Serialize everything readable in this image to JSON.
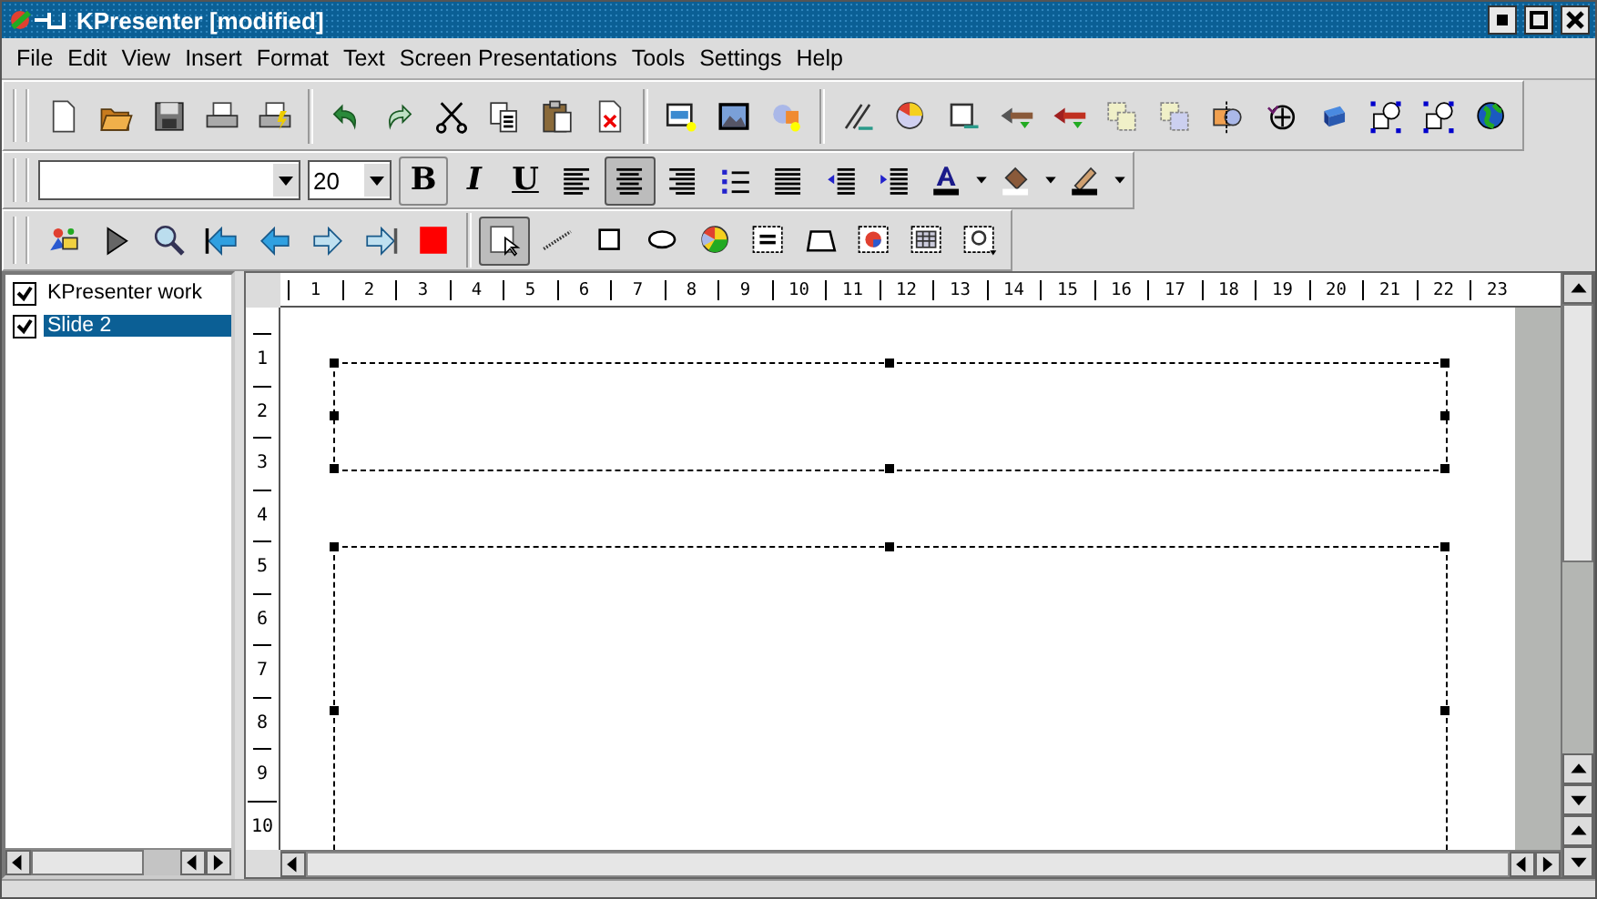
{
  "window": {
    "title": "KPresenter [modified]"
  },
  "menu": [
    {
      "label": "File"
    },
    {
      "label": "Edit"
    },
    {
      "label": "View"
    },
    {
      "label": "Insert"
    },
    {
      "label": "Format"
    },
    {
      "label": "Text"
    },
    {
      "label": "Screen Presentations"
    },
    {
      "label": "Tools"
    },
    {
      "label": "Settings"
    },
    {
      "label": "Help"
    }
  ],
  "toolbar_main": [
    {
      "buttons": [
        {
          "kind": "new"
        },
        {
          "kind": "open"
        },
        {
          "kind": "save"
        },
        {
          "kind": "print"
        },
        {
          "kind": "preview"
        }
      ]
    },
    {
      "buttons": [
        {
          "kind": "undo"
        },
        {
          "kind": "redo"
        },
        {
          "kind": "cut"
        },
        {
          "kind": "copy"
        },
        {
          "kind": "paste"
        },
        {
          "kind": "delete"
        }
      ]
    },
    {
      "buttons": [
        {
          "kind": "slide"
        },
        {
          "kind": "image"
        },
        {
          "kind": "clipart"
        }
      ]
    },
    {
      "buttons": [
        {
          "kind": "pen"
        },
        {
          "kind": "palette"
        },
        {
          "kind": "frame"
        },
        {
          "kind": "back"
        },
        {
          "kind": "front"
        },
        {
          "kind": "raise"
        },
        {
          "kind": "lower"
        },
        {
          "kind": "align"
        },
        {
          "kind": "rotate"
        },
        {
          "kind": "shadow"
        },
        {
          "kind": "group"
        },
        {
          "kind": "ungroup"
        },
        {
          "kind": "globe"
        }
      ]
    }
  ],
  "format_bar": {
    "size": {
      "value": "20"
    },
    "buttons": [
      {
        "kind": "bold",
        "label": "B",
        "selected": false
      },
      {
        "kind": "italic",
        "label": "I",
        "selected": false
      },
      {
        "kind": "underline",
        "label": "U",
        "selected": false
      },
      {
        "kind": "align-left",
        "selected": false
      },
      {
        "kind": "align-center",
        "selected": true
      },
      {
        "kind": "align-right",
        "selected": false
      },
      {
        "kind": "list",
        "selected": false
      },
      {
        "kind": "justify",
        "selected": false
      },
      {
        "kind": "indent-less",
        "selected": false
      },
      {
        "kind": "indent-more",
        "selected": false
      },
      {
        "kind": "text-color",
        "selected": false
      },
      {
        "kind": "fill-color",
        "selected": false
      },
      {
        "kind": "pen-color",
        "selected": false
      }
    ]
  },
  "toolbar_tools": {
    "navigation": [
      {
        "kind": "presentation"
      },
      {
        "kind": "play"
      },
      {
        "kind": "zoom"
      },
      {
        "kind": "first"
      },
      {
        "kind": "prev"
      },
      {
        "kind": "next"
      },
      {
        "kind": "last"
      },
      {
        "kind": "stop"
      }
    ],
    "drawing": [
      {
        "kind": "select",
        "selected": true
      },
      {
        "kind": "line",
        "selected": false
      },
      {
        "kind": "rect",
        "selected": false
      },
      {
        "kind": "ellipse",
        "selected": false
      },
      {
        "kind": "pie",
        "selected": false
      },
      {
        "kind": "textbox",
        "selected": false
      },
      {
        "kind": "polygon",
        "selected": false
      },
      {
        "kind": "chart",
        "selected": false
      },
      {
        "kind": "table",
        "selected": false
      },
      {
        "kind": "object",
        "selected": false
      }
    ]
  },
  "sidebar": {
    "items": [
      {
        "label": "KPresenter work",
        "checked": true,
        "selected": false
      },
      {
        "label": "Slide 2",
        "checked": true,
        "selected": true
      }
    ]
  },
  "rulers": {
    "horizontal": [
      "1",
      "2",
      "3",
      "4",
      "5",
      "6",
      "7",
      "8",
      "9",
      "10",
      "11",
      "12",
      "13",
      "14",
      "15",
      "16",
      "17",
      "18",
      "19",
      "20",
      "21",
      "22",
      "23"
    ],
    "vertical": [
      "1",
      "2",
      "3",
      "4",
      "5",
      "6",
      "7",
      "8",
      "9",
      "10"
    ]
  }
}
